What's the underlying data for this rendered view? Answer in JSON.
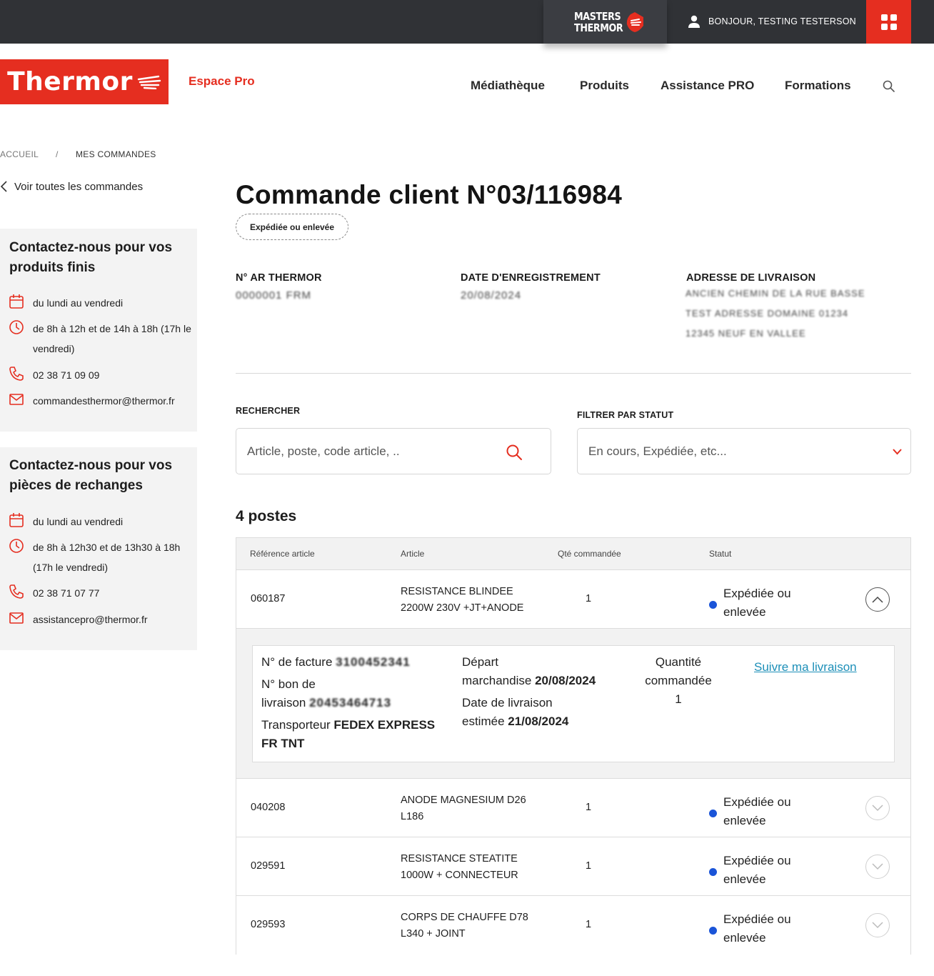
{
  "topbar": {
    "masters_line1": "MASTERS",
    "masters_line2": "THERMOR",
    "greeting": "BONJOUR, TESTING TESTERSON"
  },
  "header": {
    "logo_text": "Thermor",
    "espace": "Espace Pro",
    "nav": [
      "Médiathèque",
      "Produits",
      "Assistance PRO",
      "Formations"
    ]
  },
  "breadcrumb": {
    "home": "ACCUEIL",
    "sep": "/",
    "current": "MES COMMANDES"
  },
  "back_link": "Voir toutes les commandes",
  "contact_products": {
    "title_line1": "Contactez-nous pour vos",
    "title_line2": "produits finis",
    "days": "du lundi au vendredi",
    "hours_line1": "de 8h à 12h et de 14h à 18h (17h le",
    "hours_line2": "vendredi)",
    "phone": "02 38 71 09 09",
    "email": "commandesthermor@thermor.fr"
  },
  "contact_parts": {
    "title_line1": "Contactez-nous pour vos",
    "title_line2": "pièces de rechanges",
    "days": "du lundi au vendredi",
    "hours_line1": "de 8h à 12h30 et de 13h30 à 18h",
    "hours_line2": "(17h le vendredi)",
    "phone": "02 38 71 07 77",
    "email": "assistancepro@thermor.fr"
  },
  "order": {
    "title": "Commande client N°03/116984",
    "status_badge": "Expédiée ou enlevée",
    "ar_label": "N° AR THERMOR",
    "ar_value": "0000001 FRM",
    "date_label": "DATE D'ENREGISTREMENT",
    "date_value": "20/08/2024",
    "address_label": "ADRESSE DE LIVRAISON",
    "address_lines": [
      "ANCIEN CHEMIN DE LA RUE BASSE",
      "TEST ADRESSE DOMAINE 01234",
      "12345 NEUF EN VALLEE"
    ]
  },
  "filters": {
    "search_label": "RECHERCHER",
    "search_placeholder": "Article, poste, code article, ..",
    "status_label": "FILTRER PAR STATUT",
    "status_placeholder": "En cours, Expédiée, etc..."
  },
  "postes_count": "4 postes",
  "table": {
    "headers": [
      "Référence article",
      "Article",
      "Qté commandée",
      "Statut"
    ],
    "rows": [
      {
        "ref": "060187",
        "article_line1": "RESISTANCE BLINDEE",
        "article_line2": "2200W 230V +JT+ANODE",
        "qty": "1",
        "status_line1": "Expédiée ou",
        "status_line2": "enlevée"
      },
      {
        "ref": "040208",
        "article_line1": "ANODE MAGNESIUM D26",
        "article_line2": "L186",
        "qty": "1",
        "status_line1": "Expédiée ou",
        "status_line2": "enlevée"
      },
      {
        "ref": "029591",
        "article_line1": "RESISTANCE STEATITE",
        "article_line2": "1000W + CONNECTEUR",
        "qty": "1",
        "status_line1": "Expédiée ou",
        "status_line2": "enlevée"
      },
      {
        "ref": "029593",
        "article_line1": "CORPS DE CHAUFFE D78",
        "article_line2": "L340 + JOINT",
        "qty": "1",
        "status_line1": "Expédiée ou",
        "status_line2": "enlevée"
      }
    ],
    "detail": {
      "invoice_label": "N° de facture",
      "invoice_value": "3100452341",
      "delivery_label_line1": "N° bon de",
      "delivery_label_line2": "livraison",
      "delivery_value": "20453464713",
      "carrier_label": "Transporteur",
      "carrier_value_line1": "FEDEX EXPRESS",
      "carrier_value_line2": "FR TNT",
      "depart_line1": "Départ",
      "depart_label_line2": "marchandise",
      "depart_date": "20/08/2024",
      "estimate_line1": "Date de livraison",
      "estimate_label_line2": "estimée",
      "estimate_date": "21/08/2024",
      "qty_line1": "Quantité",
      "qty_line2": "commandée",
      "qty_value": "1",
      "track_link": "Suivre ma livraison"
    }
  },
  "colors": {
    "brand_red": "#e52e20",
    "status_blue": "#1a54d8",
    "link_blue": "#1c8fb8",
    "topbar": "#303236"
  }
}
